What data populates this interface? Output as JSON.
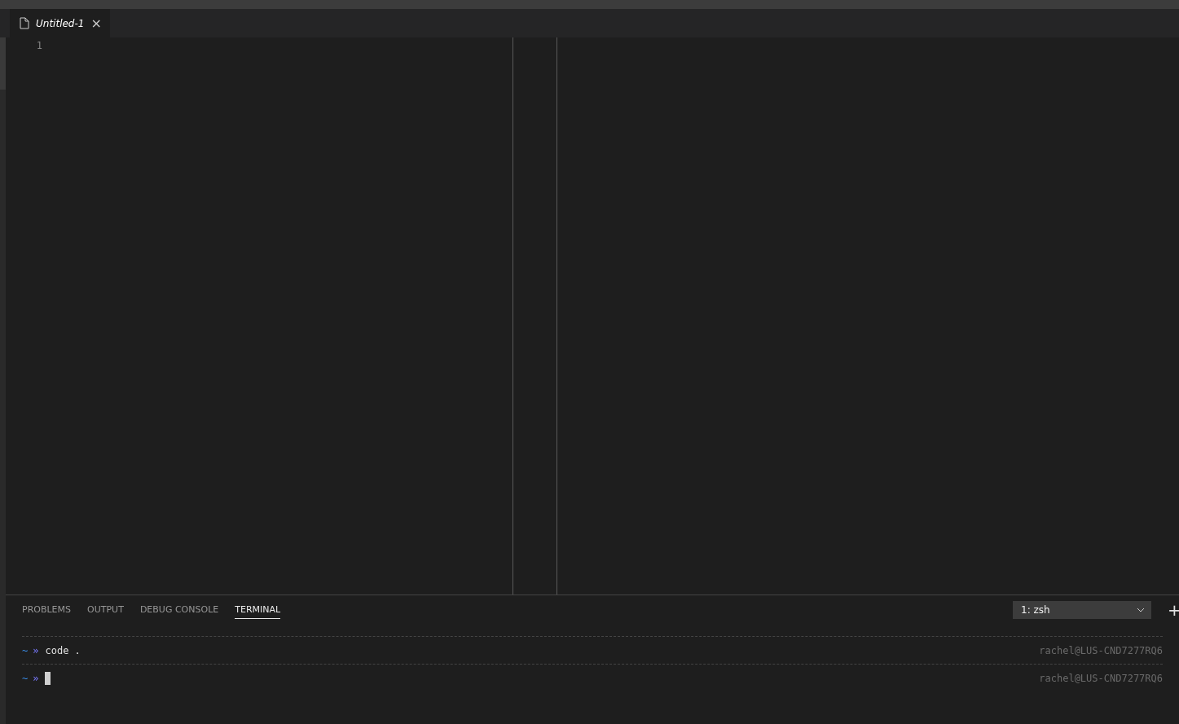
{
  "editor_tabs": [
    {
      "label": "Untitled-1",
      "selected": true,
      "close": "×"
    }
  ],
  "editor": {
    "line_numbers": [
      "1"
    ]
  },
  "panel": {
    "tabs": [
      {
        "label": "PROBLEMS",
        "selected": false
      },
      {
        "label": "OUTPUT",
        "selected": false
      },
      {
        "label": "DEBUG CONSOLE",
        "selected": false
      },
      {
        "label": "TERMINAL",
        "selected": true
      }
    ],
    "terminal_dropdown": {
      "value": "1: zsh"
    },
    "new_terminal": "+"
  },
  "terminal": {
    "lines": [
      {
        "tilde": "~",
        "arrow": "»",
        "command": "code .",
        "host": "rachel@LUS-CND7277RQ6",
        "cursor": false
      },
      {
        "tilde": "~",
        "arrow": "»",
        "host": "rachel@LUS-CND7277RQ6",
        "cursor": true
      }
    ]
  }
}
